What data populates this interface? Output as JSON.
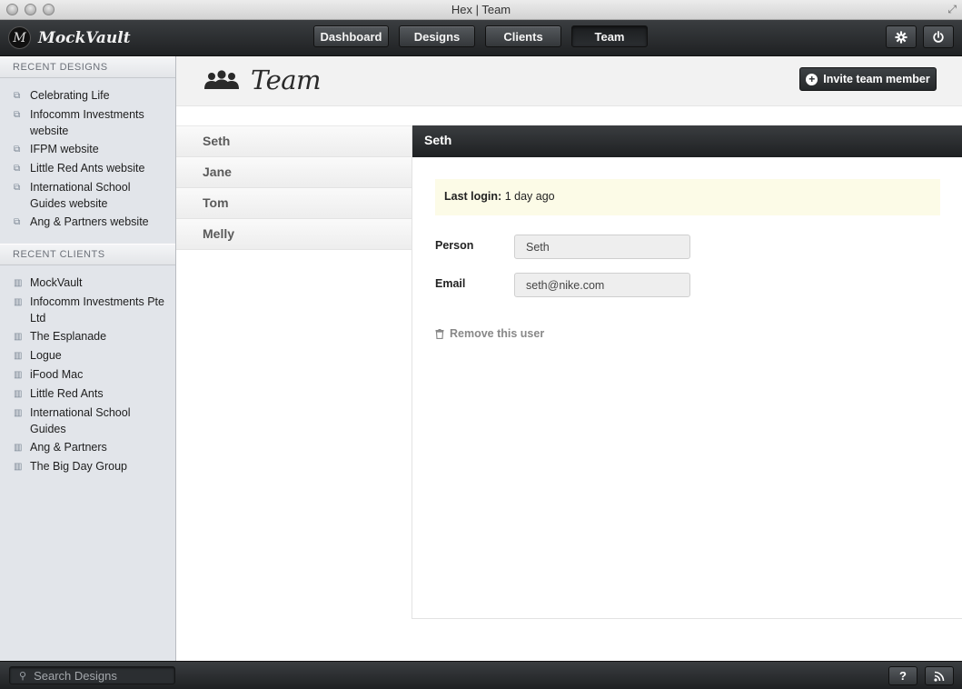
{
  "window": {
    "title": "Hex | Team"
  },
  "app": {
    "name": "MockVault",
    "logo_glyph": "M"
  },
  "nav": {
    "items": [
      {
        "label": "Dashboard",
        "active": false
      },
      {
        "label": "Designs",
        "active": false
      },
      {
        "label": "Clients",
        "active": false
      },
      {
        "label": "Team",
        "active": true
      }
    ],
    "settings_icon": "gear-icon",
    "power_icon": "power-icon"
  },
  "sidebar": {
    "recent_designs_header": "RECENT DESIGNS",
    "recent_designs": [
      "Celebrating Life",
      "Infocomm Investments website",
      "IFPM website",
      "Little Red Ants website",
      "International School Guides website",
      "Ang & Partners website"
    ],
    "recent_clients_header": "RECENT CLIENTS",
    "recent_clients": [
      "MockVault",
      "Infocomm Investments Pte Ltd",
      "The Esplanade",
      "Logue",
      "iFood Mac",
      "Little Red Ants",
      "International School Guides",
      "Ang & Partners",
      "The Big Day Group"
    ]
  },
  "page": {
    "title": "Team",
    "invite_label": "Invite team member"
  },
  "team": {
    "members": [
      "Seth",
      "Jane",
      "Tom",
      "Melly"
    ],
    "selected": "Seth"
  },
  "detail": {
    "name": "Seth",
    "last_login_label": "Last login:",
    "last_login_value": "1 day ago",
    "person_label": "Person",
    "person_value": "Seth",
    "email_label": "Email",
    "email_value": "seth@nike.com",
    "remove_label": "Remove this user"
  },
  "footer": {
    "search_placeholder": "Search Designs",
    "help_label": "?",
    "rss_icon": "rss-icon"
  },
  "colors": {
    "toolbar_dark": "#2b2e31",
    "sidebar_bg": "#e2e5ea",
    "notice_bg": "#fcfbe7"
  }
}
